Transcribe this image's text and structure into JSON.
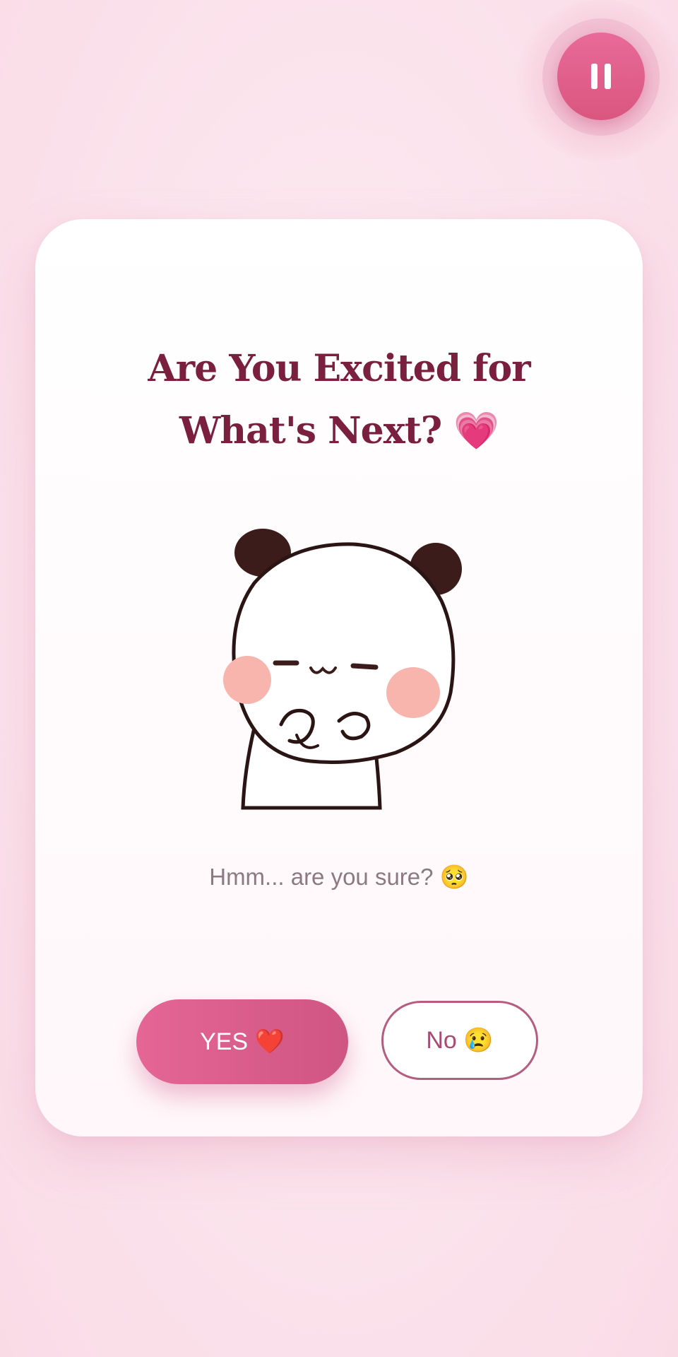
{
  "controls": {
    "pause_icon": "pause-icon"
  },
  "card": {
    "title": "Are You Excited for What's Next? 💗",
    "subtitle": "Hmm... are you sure? 🥺",
    "yes_label": "YES ❤️",
    "no_label": "No 😢",
    "illustration_icon": "panda-bear-sticker"
  },
  "colors": {
    "accent": "#e06592",
    "title": "#7b1f3f",
    "background": "#fbe3ec",
    "card": "#ffffff",
    "no_border": "#b55d80"
  }
}
